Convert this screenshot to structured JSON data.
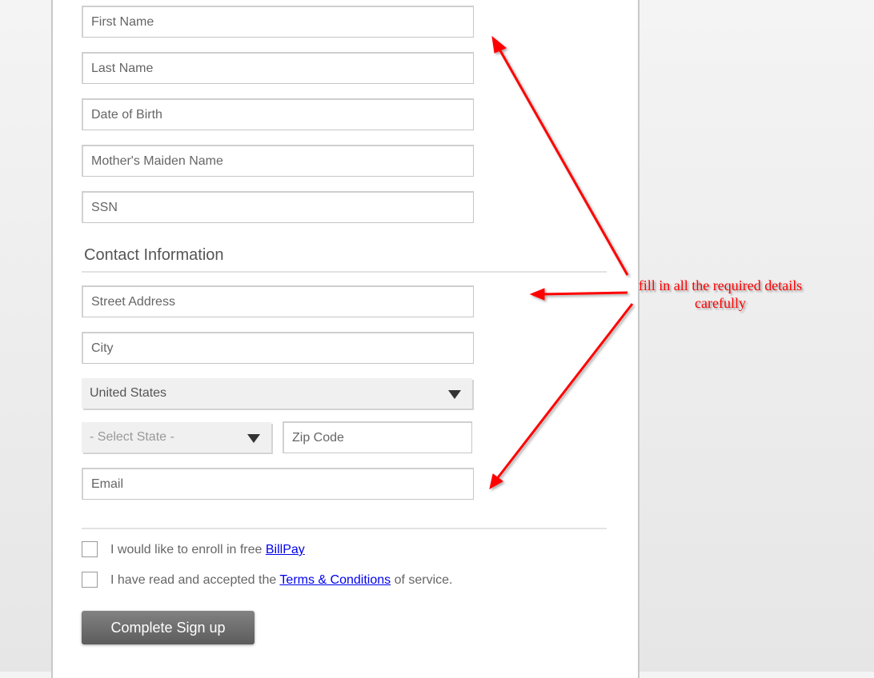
{
  "form": {
    "personal_fields": [
      {
        "name": "first-name",
        "placeholder": "First Name",
        "value": ""
      },
      {
        "name": "last-name",
        "placeholder": "Last Name",
        "value": ""
      },
      {
        "name": "date-of-birth",
        "placeholder": "Date of Birth",
        "value": ""
      },
      {
        "name": "mothers-maiden-name",
        "placeholder": "Mother's Maiden Name",
        "value": ""
      },
      {
        "name": "ssn",
        "placeholder": "SSN",
        "value": ""
      }
    ],
    "contact_section_title": "Contact Information",
    "street_address": {
      "placeholder": "Street Address",
      "value": ""
    },
    "city": {
      "placeholder": "City",
      "value": ""
    },
    "country_select": {
      "selected": "United States"
    },
    "state_select": {
      "selected": "- Select State -"
    },
    "zip_code": {
      "placeholder": "Zip Code",
      "value": ""
    },
    "email": {
      "placeholder": "Email",
      "value": ""
    },
    "billpay_checkbox": {
      "checked": false,
      "label_prefix": "I would like to enroll in free ",
      "link_text": "BillPay",
      "label_suffix": ""
    },
    "terms_checkbox": {
      "checked": false,
      "label_prefix": "I have read and accepted the ",
      "link_text": "Terms & Conditions",
      "label_suffix": " of service."
    },
    "submit_label": "Complete Sign up"
  },
  "annotation": {
    "line1": "fill in all the required details",
    "line2": "carefully",
    "color": "#ff0000"
  }
}
